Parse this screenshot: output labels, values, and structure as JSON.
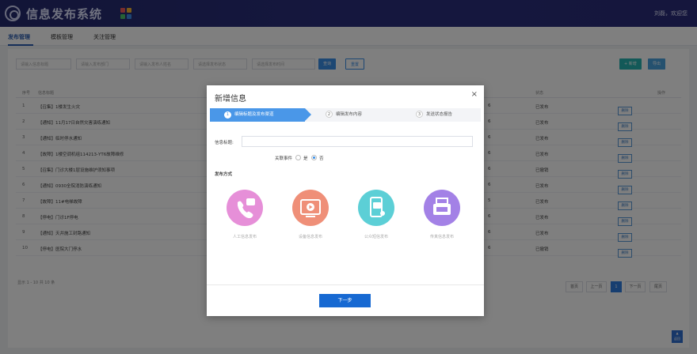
{
  "header": {
    "app_title": "信息发布系统",
    "user_greeting": "刘磊，欢迎您"
  },
  "nav": {
    "items": [
      {
        "label": "发布管理",
        "active": true
      },
      {
        "label": "模板管理",
        "active": false
      },
      {
        "label": "关注管理",
        "active": false
      }
    ]
  },
  "filters": {
    "placeholders": [
      "请输入信息标题",
      "请输入发布部门",
      "请输入发布人姓名",
      "请选择发布状态",
      "请选择发布时间"
    ],
    "search_label": "查询",
    "reset_label": "重置",
    "add_label": "+ 新增",
    "export_label": "导出"
  },
  "table": {
    "headers": [
      "序号",
      "信息标题",
      "状态",
      "操作"
    ],
    "rows": [
      {
        "num": "1",
        "title": "【召集】1楼发生火灾",
        "count": "6",
        "status": "已发布",
        "ops": [
          "查看",
          "修改",
          "删除"
        ]
      },
      {
        "num": "2",
        "title": "【通知】11月17日自然灾害演练通知",
        "count": "6",
        "status": "已发布",
        "ops": [
          "查看",
          "修改",
          "删除"
        ]
      },
      {
        "num": "3",
        "title": "【通知】临时停水通知",
        "count": "6",
        "status": "已发布",
        "ops": [
          "查看",
          "修改",
          "删除"
        ]
      },
      {
        "num": "4",
        "title": "【故障】1楼空调机组114213-YT6故障维修",
        "count": "6",
        "status": "已发布",
        "ops": [
          "查看",
          "修改",
          "删除"
        ]
      },
      {
        "num": "5",
        "title": "【召集】门诊大楼1层设施维护须知事项",
        "count": "6",
        "status": "已撤销",
        "ops": [
          "查看",
          "修改",
          "删除"
        ]
      },
      {
        "num": "6",
        "title": "【通知】0930全院消防演练通知",
        "count": "6",
        "status": "已发布",
        "ops": [
          "查看",
          "修改",
          "删除"
        ]
      },
      {
        "num": "7",
        "title": "【故障】11#电梯故障",
        "count": "5",
        "status": "已发布",
        "ops": [
          "查看",
          "修改",
          "删除"
        ]
      },
      {
        "num": "8",
        "title": "【停电】门诊1F停电",
        "count": "6",
        "status": "已发布",
        "ops": [
          "查看",
          "修改",
          "删除"
        ]
      },
      {
        "num": "9",
        "title": "【通知】天井施工封路通知",
        "count": "6",
        "status": "已发布",
        "ops": [
          "查看",
          "修改",
          "删除"
        ]
      },
      {
        "num": "10",
        "title": "【停电】医院大门停水",
        "count": "6",
        "status": "已撤销",
        "ops": [
          "查看",
          "修改",
          "删除"
        ]
      }
    ]
  },
  "pagination": {
    "info": "显示 1 - 10 共 10 条",
    "first": "首页",
    "prev": "上一页",
    "current": "1",
    "next": "下一页",
    "last": "尾页"
  },
  "float_button": {
    "label": "返回"
  },
  "modal": {
    "title": "新增信息",
    "close": "×",
    "steps": [
      {
        "num": "1",
        "label": "编辑标题及发布渠道"
      },
      {
        "num": "2",
        "label": "编辑发布内容"
      },
      {
        "num": "3",
        "label": "发送状态报告"
      }
    ],
    "title_label": "信息标题:",
    "related_label": "关联事件",
    "yes_label": "是",
    "no_label": "否",
    "publish_method_label": "发布方式",
    "methods": [
      {
        "label": "人工信息发布",
        "icon": "phone-message-icon",
        "color": "#e68fd8"
      },
      {
        "label": "设备信息发布",
        "icon": "video-play-icon",
        "color": "#ef8f78"
      },
      {
        "label": "公众短信发布",
        "icon": "mobile-sms-icon",
        "color": "#5ccfd6"
      },
      {
        "label": "传真信息发布",
        "icon": "fax-icon",
        "color": "#a381e6"
      }
    ],
    "next_label": "下一步"
  }
}
